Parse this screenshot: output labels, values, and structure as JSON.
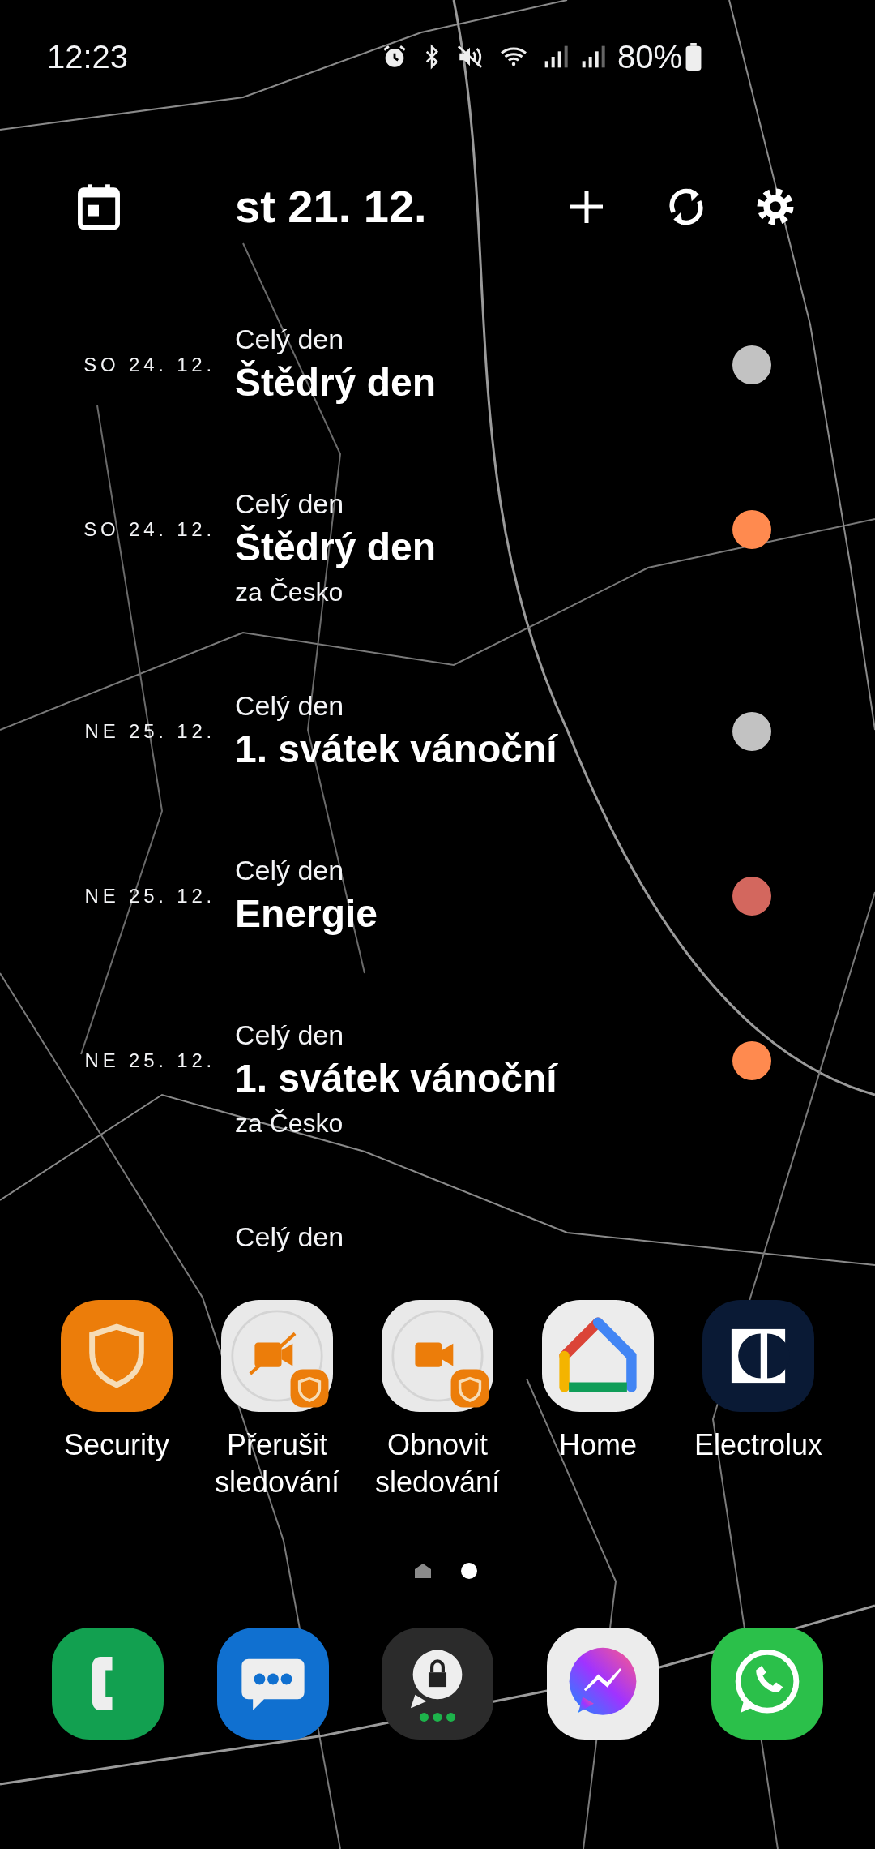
{
  "status_bar": {
    "time": "12:23",
    "battery": "80%"
  },
  "widget": {
    "date": "st 21. 12.",
    "events": [
      {
        "date": "SO 24. 12.",
        "time_label": "Celý den",
        "title": "Štědrý den",
        "color": "#c2c2c2"
      },
      {
        "date": "SO 24. 12.",
        "time_label": "Celý den",
        "title": "Štědrý den",
        "subtitle": "za Česko",
        "color": "#ff8a4f"
      },
      {
        "date": "NE 25. 12.",
        "time_label": "Celý den",
        "title": "1. svátek vánoční",
        "color": "#c2c2c2"
      },
      {
        "date": "NE 25. 12.",
        "time_label": "Celý den",
        "title": "Energie",
        "color": "#d3675e"
      },
      {
        "date": "NE 25. 12.",
        "time_label": "Celý den",
        "title": "1. svátek vánoční",
        "subtitle": "za Česko",
        "color": "#ff8a4f"
      },
      {
        "time_label": "Celý den"
      }
    ]
  },
  "apps": [
    {
      "label": "Security"
    },
    {
      "label": "Přerušit sledování"
    },
    {
      "label": "Obnovit sledování"
    },
    {
      "label": "Home"
    },
    {
      "label": "Electrolux"
    }
  ],
  "page_indicator": [
    {
      "kind": "home",
      "selected": false
    },
    {
      "kind": "dot",
      "selected": true
    }
  ]
}
